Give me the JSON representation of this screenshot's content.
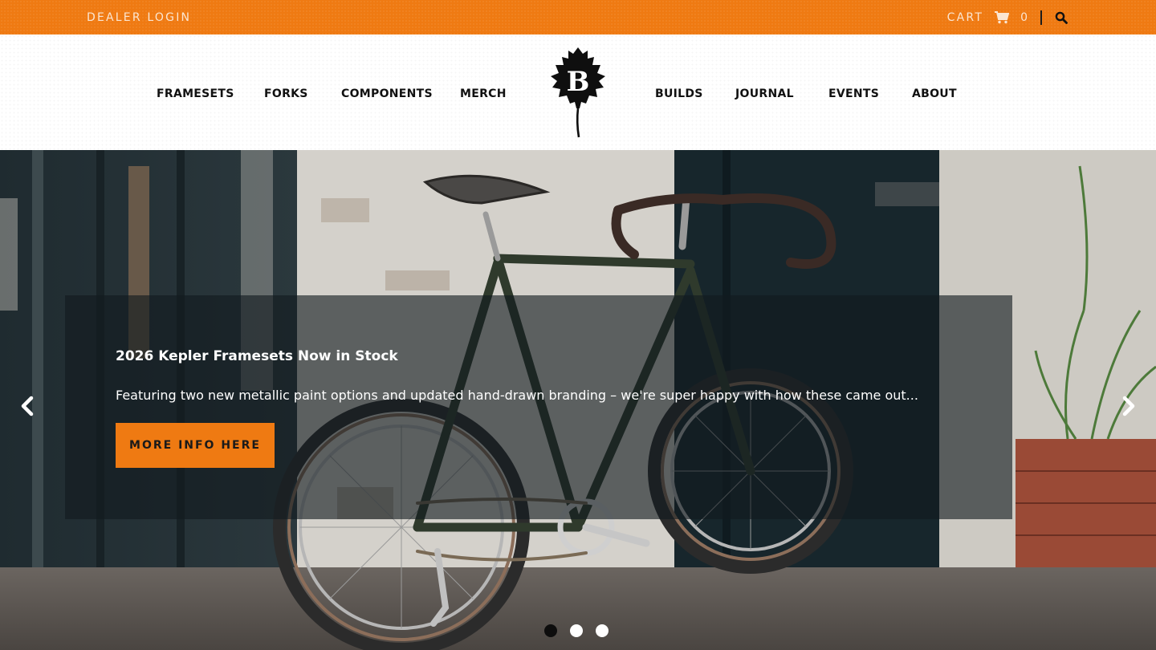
{
  "topbar": {
    "dealer_login": "DEALER LOGIN",
    "cart_label": "CART",
    "cart_count": "0",
    "cart_icon": "shopping-cart-icon",
    "search_icon": "magnifier-icon",
    "background_color": "#ef7a12"
  },
  "nav": {
    "left": [
      "FRAMESETS",
      "FORKS",
      "COMPONENTS",
      "MERCH"
    ],
    "right": [
      "BUILDS",
      "JOURNAL",
      "EVENTS",
      "ABOUT"
    ],
    "logo_letter": "B",
    "logo_icon": "oak-leaf-icon"
  },
  "hero": {
    "title": "2026 Kepler Framesets Now in Stock",
    "text": "Featuring two new metallic paint options and updated hand-drawn branding – we're super happy with how these came out...",
    "button_label": "MORE INFO HERE",
    "button_color": "#ef7a12",
    "prev_icon": "chevron-left-icon",
    "next_icon": "chevron-right-icon",
    "slides_total": 3,
    "slide_active": 1
  }
}
